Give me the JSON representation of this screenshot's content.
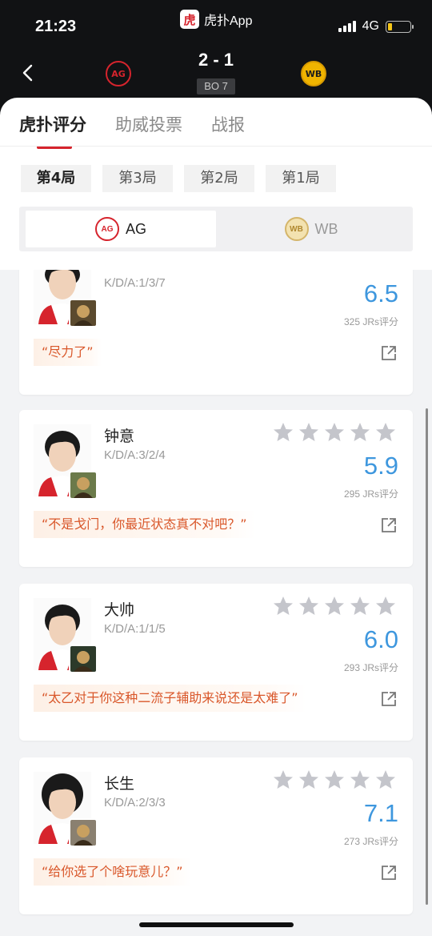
{
  "status": {
    "time": "21:23",
    "network": "4G",
    "battery_level": 0.2
  },
  "app": {
    "logo_text": "虎",
    "name": "虎扑App"
  },
  "match": {
    "score": "2 - 1",
    "format": "BO 7",
    "team_left_logo": "AG",
    "team_right_logo": "WB"
  },
  "tabs": [
    {
      "label": "虎扑评分"
    },
    {
      "label": "助威投票"
    },
    {
      "label": "战报"
    }
  ],
  "games": [
    {
      "label": "第4局"
    },
    {
      "label": "第3局"
    },
    {
      "label": "第2局"
    },
    {
      "label": "第1局"
    }
  ],
  "teams": [
    {
      "name": "AG",
      "logo": "AG"
    },
    {
      "name": "WB",
      "logo": "WB"
    }
  ],
  "colors": {
    "accent": "#d6242d",
    "rating": "#3e97de",
    "comment": "#d9572a",
    "star": "#c4c5cb"
  },
  "players": [
    {
      "name": "",
      "kda": "K/D/A:1/3/7",
      "rating": "6.5",
      "votes": "325 JRs评分",
      "comment": "“尽力了”",
      "stars": 0
    },
    {
      "name": "钟意",
      "kda": "K/D/A:3/2/4",
      "rating": "5.9",
      "votes": "295 JRs评分",
      "comment": "“不是戈门，你最近状态真不对吧？”",
      "stars": 0
    },
    {
      "name": "大帅",
      "kda": "K/D/A:1/1/5",
      "rating": "6.0",
      "votes": "293 JRs评分",
      "comment": "“太乙对于你这种二流子辅助来说还是太难了”",
      "stars": 0
    },
    {
      "name": "长生",
      "kda": "K/D/A:2/3/3",
      "rating": "7.1",
      "votes": "273 JRs评分",
      "comment": "“给你选了个啥玩意儿？”",
      "stars": 0
    }
  ]
}
